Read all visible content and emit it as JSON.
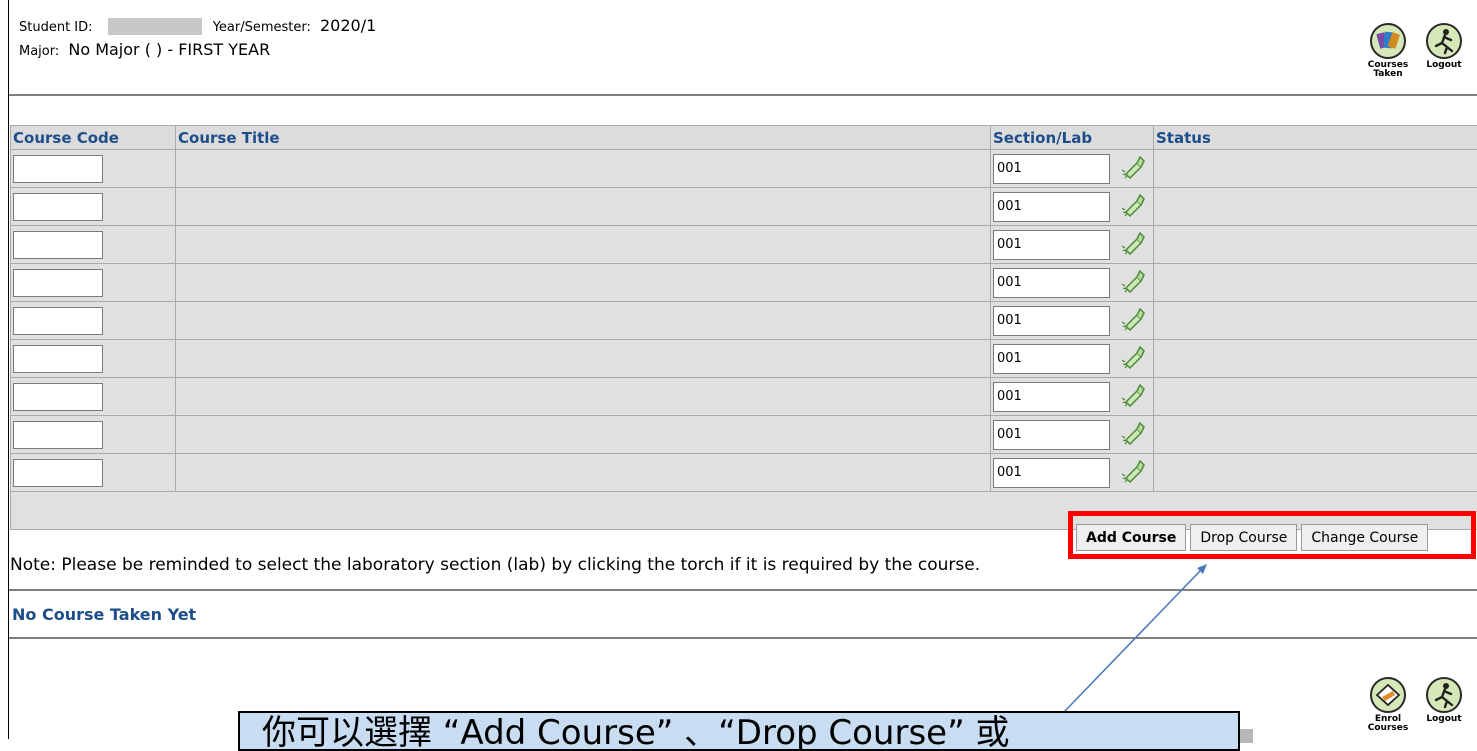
{
  "header": {
    "student_id_label": "Student ID:",
    "year_semester_label": "Year/Semester:",
    "year_semester_value": "2020/1",
    "major_label": "Major:",
    "major_value": "No Major ( ) - FIRST YEAR"
  },
  "top_icons": {
    "courses_taken_line1": "Courses",
    "courses_taken_line2": "Taken",
    "logout": "Logout"
  },
  "table": {
    "headers": {
      "code": "Course Code",
      "title": "Course Title",
      "section": "Section/Lab",
      "status": "Status"
    },
    "rows": [
      {
        "code": "",
        "title": "",
        "section": "001",
        "status": ""
      },
      {
        "code": "",
        "title": "",
        "section": "001",
        "status": ""
      },
      {
        "code": "",
        "title": "",
        "section": "001",
        "status": ""
      },
      {
        "code": "",
        "title": "",
        "section": "001",
        "status": ""
      },
      {
        "code": "",
        "title": "",
        "section": "001",
        "status": ""
      },
      {
        "code": "",
        "title": "",
        "section": "001",
        "status": ""
      },
      {
        "code": "",
        "title": "",
        "section": "001",
        "status": ""
      },
      {
        "code": "",
        "title": "",
        "section": "001",
        "status": ""
      },
      {
        "code": "",
        "title": "",
        "section": "001",
        "status": ""
      }
    ]
  },
  "buttons": {
    "add": "Add Course",
    "drop": "Drop Course",
    "change": "Change Course"
  },
  "note": "Note: Please be reminded to select the laboratory section (lab) by clicking the torch if it is required by the course.",
  "no_course": "No Course Taken Yet",
  "bottom_icons": {
    "enrol_line1": "Enrol",
    "enrol_line2": "Courses",
    "logout": "Logout"
  },
  "callout_text": "你可以選擇 “Add Course” 、“Drop Course” 或",
  "colors": {
    "link_blue": "#1d4e89",
    "highlight_red": "#ff0000",
    "callout_bg": "#c8dcf2",
    "arrow_blue": "#4a7ab8"
  }
}
